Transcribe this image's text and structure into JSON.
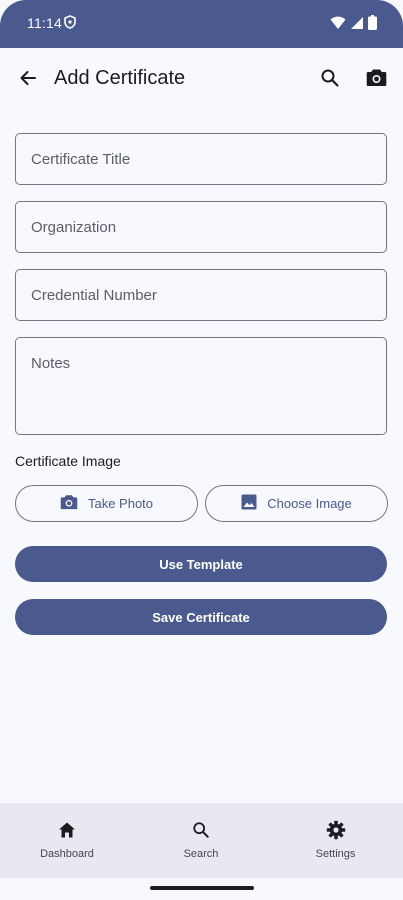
{
  "status_bar": {
    "time": "11:14"
  },
  "app_bar": {
    "title": "Add Certificate"
  },
  "form": {
    "title_placeholder": "Certificate Title",
    "organization_placeholder": "Organization",
    "credential_placeholder": "Credential Number",
    "notes_placeholder": "Notes"
  },
  "image_section": {
    "label": "Certificate Image",
    "take_photo_label": "Take Photo",
    "choose_image_label": "Choose Image"
  },
  "actions": {
    "use_template_label": "Use Template",
    "save_label": "Save Certificate"
  },
  "bottom_nav": {
    "items": [
      {
        "label": "Dashboard",
        "icon": "home-icon"
      },
      {
        "label": "Search",
        "icon": "search-icon"
      },
      {
        "label": "Settings",
        "icon": "gear-icon"
      }
    ]
  },
  "colors": {
    "primary": "#4a5a8e",
    "background": "#f8f8ff",
    "nav_background": "#e8e8f2",
    "outline": "#75777f"
  }
}
